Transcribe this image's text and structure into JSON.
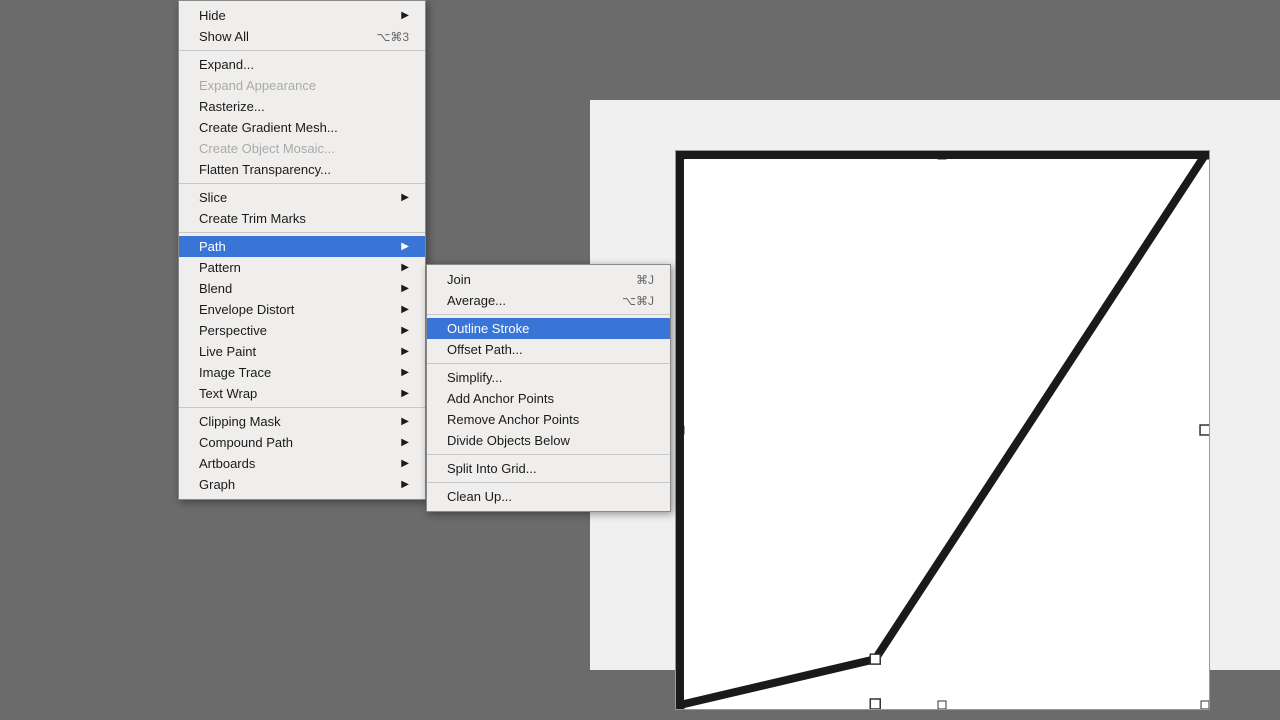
{
  "menu": {
    "items": [
      {
        "id": "hide",
        "label": "Hide",
        "shortcut": "",
        "arrow": true,
        "disabled": false,
        "separator_after": false
      },
      {
        "id": "show-all",
        "label": "Show All",
        "shortcut": "⌥⌘3",
        "arrow": false,
        "disabled": false,
        "separator_after": true
      },
      {
        "id": "expand",
        "label": "Expand...",
        "shortcut": "",
        "arrow": false,
        "disabled": false,
        "separator_after": false
      },
      {
        "id": "expand-appearance",
        "label": "Expand Appearance",
        "shortcut": "",
        "arrow": false,
        "disabled": true,
        "separator_after": false
      },
      {
        "id": "rasterize",
        "label": "Rasterize...",
        "shortcut": "",
        "arrow": false,
        "disabled": false,
        "separator_after": false
      },
      {
        "id": "create-gradient-mesh",
        "label": "Create Gradient Mesh...",
        "shortcut": "",
        "arrow": false,
        "disabled": false,
        "separator_after": false
      },
      {
        "id": "create-object-mosaic",
        "label": "Create Object Mosaic...",
        "shortcut": "",
        "arrow": false,
        "disabled": true,
        "separator_after": false
      },
      {
        "id": "flatten-transparency",
        "label": "Flatten Transparency...",
        "shortcut": "",
        "arrow": false,
        "disabled": false,
        "separator_after": true
      },
      {
        "id": "slice",
        "label": "Slice",
        "shortcut": "",
        "arrow": true,
        "disabled": false,
        "separator_after": false
      },
      {
        "id": "create-trim-marks",
        "label": "Create Trim Marks",
        "shortcut": "",
        "arrow": false,
        "disabled": false,
        "separator_after": true
      },
      {
        "id": "path",
        "label": "Path",
        "shortcut": "",
        "arrow": true,
        "disabled": false,
        "highlighted": true,
        "separator_after": false
      },
      {
        "id": "pattern",
        "label": "Pattern",
        "shortcut": "",
        "arrow": true,
        "disabled": false,
        "separator_after": false
      },
      {
        "id": "blend",
        "label": "Blend",
        "shortcut": "",
        "arrow": true,
        "disabled": false,
        "separator_after": false
      },
      {
        "id": "envelope-distort",
        "label": "Envelope Distort",
        "shortcut": "",
        "arrow": true,
        "disabled": false,
        "separator_after": false
      },
      {
        "id": "perspective",
        "label": "Perspective",
        "shortcut": "",
        "arrow": true,
        "disabled": false,
        "separator_after": false
      },
      {
        "id": "live-paint",
        "label": "Live Paint",
        "shortcut": "",
        "arrow": true,
        "disabled": false,
        "separator_after": false
      },
      {
        "id": "image-trace",
        "label": "Image Trace",
        "shortcut": "",
        "arrow": true,
        "disabled": false,
        "separator_after": false
      },
      {
        "id": "text-wrap",
        "label": "Text Wrap",
        "shortcut": "",
        "arrow": true,
        "disabled": false,
        "separator_after": true
      },
      {
        "id": "clipping-mask",
        "label": "Clipping Mask",
        "shortcut": "",
        "arrow": true,
        "disabled": false,
        "separator_after": false
      },
      {
        "id": "compound-path",
        "label": "Compound Path",
        "shortcut": "",
        "arrow": true,
        "disabled": false,
        "separator_after": false
      },
      {
        "id": "artboards",
        "label": "Artboards",
        "shortcut": "",
        "arrow": true,
        "disabled": false,
        "separator_after": false
      },
      {
        "id": "graph",
        "label": "Graph",
        "shortcut": "",
        "arrow": true,
        "disabled": false,
        "separator_after": false
      }
    ]
  },
  "submenu": {
    "items": [
      {
        "id": "join",
        "label": "Join",
        "shortcut": "⌘J",
        "separator_after": false
      },
      {
        "id": "average",
        "label": "Average...",
        "shortcut": "⌥⌘J",
        "separator_after": true
      },
      {
        "id": "outline-stroke",
        "label": "Outline Stroke",
        "shortcut": "",
        "highlighted": true,
        "separator_after": false
      },
      {
        "id": "offset-path",
        "label": "Offset Path...",
        "shortcut": "",
        "separator_after": true
      },
      {
        "id": "simplify",
        "label": "Simplify...",
        "shortcut": "",
        "separator_after": false
      },
      {
        "id": "add-anchor-points",
        "label": "Add Anchor Points",
        "shortcut": "",
        "separator_after": false
      },
      {
        "id": "remove-anchor-points",
        "label": "Remove Anchor Points",
        "shortcut": "",
        "separator_after": false
      },
      {
        "id": "divide-objects-below",
        "label": "Divide Objects Below",
        "shortcut": "",
        "separator_after": true
      },
      {
        "id": "split-into-grid",
        "label": "Split Into Grid...",
        "shortcut": "",
        "separator_after": true
      },
      {
        "id": "clean-up",
        "label": "Clean Up...",
        "shortcut": "",
        "separator_after": false
      }
    ]
  }
}
